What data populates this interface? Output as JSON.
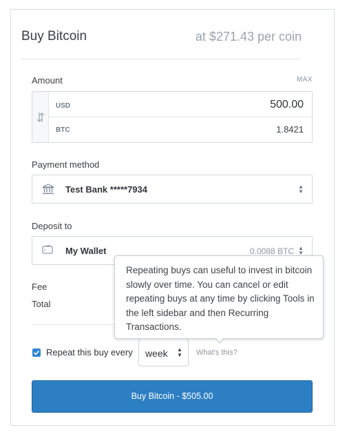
{
  "header": {
    "title": "Buy Bitcoin",
    "price": "at $271.43 per coin"
  },
  "amount": {
    "label": "Amount",
    "max_label": "MAX",
    "usd_currency": "USD",
    "usd_value": "500.00",
    "btc_currency": "BTC",
    "btc_value": "1.8421",
    "swap_icon": "swap-vertical-icon"
  },
  "payment": {
    "label": "Payment method",
    "selected": "Test Bank *****7934",
    "icon": "bank-icon"
  },
  "deposit": {
    "label": "Deposit to",
    "selected": "My Wallet",
    "balance": "0.0088 BTC",
    "icon": "wallet-icon"
  },
  "summary": {
    "fee_label": "Fee",
    "total_label": "Total"
  },
  "tooltip": {
    "text": "Repeating buys can useful to invest in bitcoin slowly over time. You can cancel or edit repeating buys at any time by clicking Tools in the left sidebar and then Recurring Transactions."
  },
  "repeat": {
    "checked": true,
    "label": "Repeat this buy every",
    "period": "week",
    "help_link": "What's this?"
  },
  "buy_button": {
    "label": "Buy Bitcoin - $505.00"
  },
  "colors": {
    "accent": "#2d7fc4",
    "muted": "#8b96a2",
    "border": "#d3d8dc"
  }
}
